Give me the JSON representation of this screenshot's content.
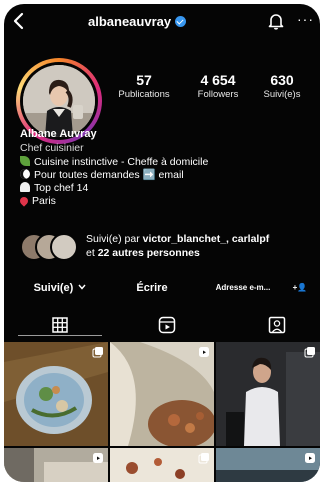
{
  "header": {
    "username": "albaneauvray",
    "back_icon": "chevron-left-icon",
    "verified_icon": "verified-badge-icon",
    "notification_icon": "bell-icon",
    "more_icon": "more-icon",
    "more_label": "···"
  },
  "profile": {
    "stats": [
      {
        "value": "57",
        "label": "Publications"
      },
      {
        "value": "4 654",
        "label": "Followers"
      },
      {
        "value": "630",
        "label": "Suivi(e)s"
      }
    ],
    "name": "Albane Auvray",
    "category": "Chef cuisinier",
    "bio_lines": [
      {
        "icon": "seedling-icon",
        "text": "Cuisine instinctive - Cheffe à domicile"
      },
      {
        "icon": "eyes-icon",
        "text": "Pour toutes demandes ➡️ email"
      },
      {
        "icon": "chef-icon",
        "text": "Top chef 14"
      },
      {
        "icon": "pin-icon",
        "text": "Paris"
      }
    ]
  },
  "followed_by": {
    "prefix": "Suivi(e) par",
    "names": "victor_blanchet_, carlalpf",
    "suffix_prefix": "et",
    "others": "22 autres personnes"
  },
  "actions": {
    "following": "Suivi(e)",
    "following_icon": "chevron-down-icon",
    "message": "Écrire",
    "email": "Adresse e-m...",
    "add_user": "+👤"
  },
  "tabs": [
    {
      "icon": "grid-icon",
      "active": true
    },
    {
      "icon": "reels-icon",
      "active": false
    },
    {
      "icon": "tagged-icon",
      "active": false
    }
  ],
  "colors": {
    "background": "#050505",
    "text": "#ffffff",
    "verified": "#3897f0",
    "button": "#262626"
  }
}
